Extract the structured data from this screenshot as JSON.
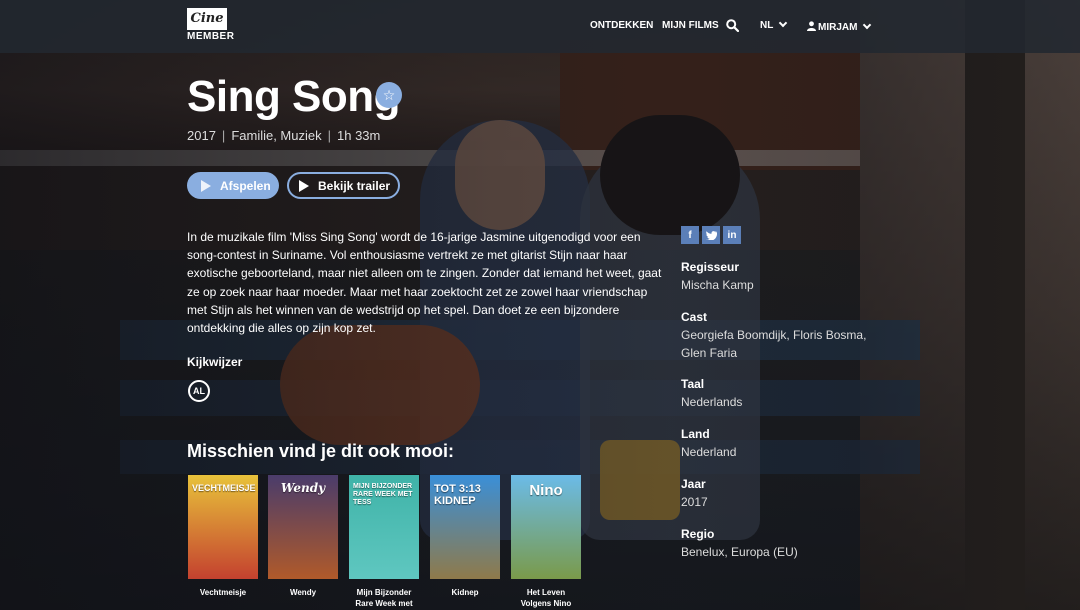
{
  "header": {
    "logo_top": "Cine",
    "logo_bottom": "MEMBER",
    "nav_discover": "ONTDEKKEN",
    "nav_my_films": "MIJN FILMS",
    "language": "NL",
    "user": "MIRJAM",
    "search_icon": "search-icon",
    "user_icon": "user-icon"
  },
  "movie": {
    "title": "Sing Song",
    "year": "2017",
    "genres": "Familie, Muziek",
    "duration": "1h 33m",
    "separator": "|",
    "favorite_icon": "star-icon",
    "play_label": "Afspelen",
    "trailer_label": "Bekijk trailer",
    "description": "In de muzikale film 'Miss Sing Song' wordt de 16-jarige Jasmine uitgenodigd voor een song-contest in Suriname. Vol enthousiasme vertrekt ze met gitarist Stijn naar haar exotische geboorteland, maar niet alleen om te zingen. Zonder dat iemand het weet, gaat ze op zoek naar haar moeder. Maar met haar zoektocht zet ze zowel haar vriendschap met Stijn als het winnen van de wedstrijd op het spel. Dan doet ze een bijzondere ontdekking die alles op zijn kop zet.",
    "kijkwijzer_label": "Kijkwijzer",
    "kijkwijzer_rating": "AL"
  },
  "share": {
    "facebook": "f",
    "twitter": "t",
    "linkedin": "in"
  },
  "info": [
    {
      "label": "Regisseur",
      "value": "Mischa Kamp"
    },
    {
      "label": "Cast",
      "value": "Georgiefa Boomdijk, Floris Bosma, Glen Faria"
    },
    {
      "label": "Taal",
      "value": "Nederlands"
    },
    {
      "label": "Land",
      "value": "Nederland"
    },
    {
      "label": "Jaar",
      "value": "2017"
    },
    {
      "label": "Regio",
      "value": "Benelux, Europa (EU)"
    }
  ],
  "recommendations": {
    "title": "Misschien vind je dit ook mooi:",
    "items": [
      {
        "label": "Vechtmeisje",
        "poster_text": "VECHTMEISJE",
        "color_top": "#e8c23a",
        "color_bottom": "#c4412f"
      },
      {
        "label": "Wendy",
        "poster_text": "Wendy",
        "color_top": "#4a3c6b",
        "color_bottom": "#b05a2a"
      },
      {
        "label": "Mijn Bijzonder Rare Week met",
        "poster_text": "MIJN BIJZONDER RARE WEEK MET TESS",
        "color_top": "#3fb3a8",
        "color_bottom": "#5fc7c0"
      },
      {
        "label": "Kidnep",
        "poster_text": "TOT 3:13 KIDNEP",
        "color_top": "#3a8fd8",
        "color_bottom": "#8f7a4a"
      },
      {
        "label": "Het Leven Volgens Nino",
        "poster_text": "Nino",
        "color_top": "#6bbbe8",
        "color_bottom": "#7a9a4a"
      }
    ]
  }
}
